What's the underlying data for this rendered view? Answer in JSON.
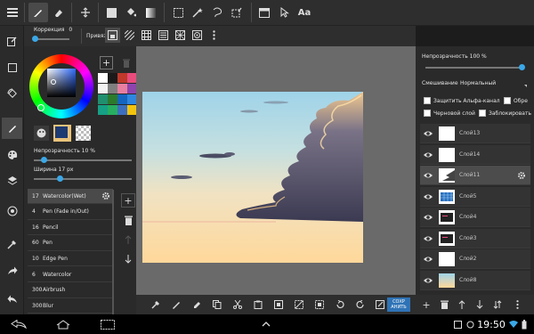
{
  "toolbar": {
    "text_tool_label": "Aa"
  },
  "subbar": {
    "correction_label": "Коррекция",
    "correction_value": "0",
    "snap_label": "Привязка"
  },
  "colors": {
    "accent": "#3aa8e8",
    "save_button": "#2f73b6",
    "current_color": "#1e3a73",
    "palette": [
      "#ffffff",
      "#1a1a1a",
      "#c0392b",
      "#e84c7d",
      "#f2f2f2",
      "#7f7f7f",
      "#e87ea0",
      "#8e44ad",
      "#1f8f6f",
      "#2c7a2c",
      "#1565c0",
      "#2e86de",
      "#16a085",
      "#27ae60",
      "#3d6fbf",
      "#f1c40f"
    ]
  },
  "brushpanel": {
    "opacity_label": "Непрозрачность 10 %",
    "opacity_value": 10,
    "width_label": "Ширина 17 px",
    "width_value": 17,
    "brushes": [
      {
        "size": "17",
        "name": "Watercolor(Wet)"
      },
      {
        "size": "4",
        "name": "Pen (Fade in/Out)"
      },
      {
        "size": "16",
        "name": "Pencil"
      },
      {
        "size": "60",
        "name": "Pen"
      },
      {
        "size": "10",
        "name": "Edge Pen"
      },
      {
        "size": "6",
        "name": "Watercolor"
      },
      {
        "size": "300",
        "name": "Airbrush"
      },
      {
        "size": "300",
        "name": "Blur"
      }
    ]
  },
  "canvasbar": {
    "save_label_line1": "СОХР",
    "save_label_line2": "АНИТЬ"
  },
  "rightpanel": {
    "opacity_label": "Непрозрачность 100 %",
    "opacity_value": 100,
    "blend_label": "Смешивание",
    "blend_value": "Нормальный",
    "protect_alpha_label": "Защитить Альфа-канал",
    "clip_label": "Обре",
    "draft_label": "Черновой слой",
    "lock_label": "Заблокировать",
    "layers": [
      {
        "name": "Слой13",
        "thumb": "white"
      },
      {
        "name": "Слой14",
        "thumb": "white"
      },
      {
        "name": "Слой11",
        "thumb": "white"
      },
      {
        "name": "Слой5",
        "thumb": "grid"
      },
      {
        "name": "Слой4",
        "thumb": "dark"
      },
      {
        "name": "Слой3",
        "thumb": "dark"
      },
      {
        "name": "Слой2",
        "thumb": "white"
      },
      {
        "name": "Слой8",
        "thumb": "sky"
      }
    ]
  },
  "navbar": {
    "clock": "19:50"
  }
}
